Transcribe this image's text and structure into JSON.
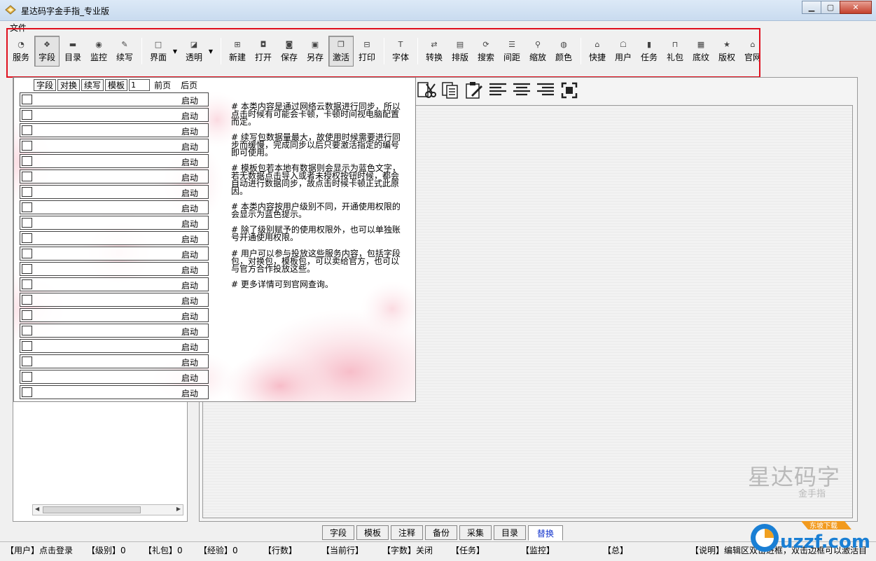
{
  "window": {
    "title": "星达码字金手指_专业版"
  },
  "menu": {
    "items": [
      "文件"
    ]
  },
  "toolbar": {
    "groups": [
      [
        {
          "label": "服务",
          "icon": "rss-icon"
        },
        {
          "label": "字段",
          "icon": "diamond-icon",
          "pressed": true
        },
        {
          "label": "目录",
          "icon": "folder-icon"
        },
        {
          "label": "监控",
          "icon": "monitor-icon"
        },
        {
          "label": "续写",
          "icon": "pen-icon"
        }
      ],
      [
        {
          "label": "界面",
          "icon": "window-icon",
          "dropdown": true
        },
        {
          "label": "透明",
          "icon": "transparency-icon",
          "dropdown": true
        }
      ],
      [
        {
          "label": "新建",
          "icon": "new-icon"
        },
        {
          "label": "打开",
          "icon": "open-icon"
        },
        {
          "label": "保存",
          "icon": "save-icon"
        },
        {
          "label": "另存",
          "icon": "save-as-icon"
        },
        {
          "label": "激活",
          "icon": "activate-icon",
          "pressed": true
        },
        {
          "label": "打印",
          "icon": "print-icon"
        }
      ],
      [
        {
          "label": "字体",
          "icon": "font-icon"
        }
      ],
      [
        {
          "label": "转换",
          "icon": "convert-icon"
        },
        {
          "label": "排版",
          "icon": "layout-icon"
        },
        {
          "label": "搜索",
          "icon": "search-icon"
        },
        {
          "label": "间距",
          "icon": "spacing-icon"
        },
        {
          "label": "缩放",
          "icon": "zoom-icon"
        },
        {
          "label": "颜色",
          "icon": "color-icon"
        }
      ],
      [
        {
          "label": "快捷",
          "icon": "shortcut-icon"
        },
        {
          "label": "用户",
          "icon": "user-icon"
        },
        {
          "label": "任务",
          "icon": "task-icon"
        },
        {
          "label": "礼包",
          "icon": "gift-icon"
        },
        {
          "label": "底纹",
          "icon": "texture-icon"
        },
        {
          "label": "版权",
          "icon": "star-icon"
        },
        {
          "label": "官网",
          "icon": "home-icon"
        }
      ]
    ]
  },
  "popup": {
    "header_buttons": [
      "字段",
      "对换",
      "续写",
      "模板"
    ],
    "page_input": "1",
    "prev_label": "前页",
    "next_label": "后页",
    "row_button_label": "启动",
    "row_count": 20,
    "help": [
      "# 本类内容是通过网络云数据进行同步，所以点击时候有可能会卡顿，卡顿时间视电脑配置而定。",
      "# 续写包数据量最大，故使用时候需要进行同步而缓慢，完成同步以后只要激活指定的编号即可使用。",
      "# 模板包若本地有数据则会显示为蓝色文字，若无数据点击导入或者未授权按钮时候，都会自动进行数据同步，故点击时候卡顿正式此原因。",
      "# 本类内容按用户级别不同，开通使用权限的会显示为蓝色提示。",
      "# 除了级别赋予的使用权限外，也可以单独账号开通使用权限。",
      "# 用户可以参与投放这些服务内容，包括字段包，对换包，模板包，可以卖给官方，也可以与官方合作投放这些。",
      "# 更多详情可到官网查询。"
    ]
  },
  "editor": {
    "tools": [
      "cut-icon",
      "copy-icon",
      "paste-icon",
      "align-left-icon",
      "align-center-icon",
      "align-right-icon",
      "fullscreen-icon"
    ],
    "watermark_big": "星达码字",
    "watermark_small": "金手指"
  },
  "tabs": {
    "items": [
      "字段",
      "模板",
      "注释",
      "备份",
      "采集",
      "目录",
      "替换"
    ],
    "active": "替换"
  },
  "status": [
    {
      "text": "【用户】点击登录"
    },
    {
      "text": "【级别】0"
    },
    {
      "text": "【礼包】0"
    },
    {
      "text": "【经验】0"
    },
    {
      "text": "【行数】"
    },
    {
      "text": "【当前行】"
    },
    {
      "text": "【字数】关闭"
    },
    {
      "text": "【任务】"
    },
    {
      "text": "【监控】"
    },
    {
      "text": "【总】"
    },
    {
      "text": "【说明】编辑区双击进框，双击边框可以激活目"
    }
  ],
  "corner_logo": {
    "text": "uzzf.com",
    "tagline": "东坡下载"
  },
  "colors": {
    "highlight": "#e0101e",
    "active_tab_text": "#1133cc",
    "logo_blue": "#1a7fd4"
  }
}
